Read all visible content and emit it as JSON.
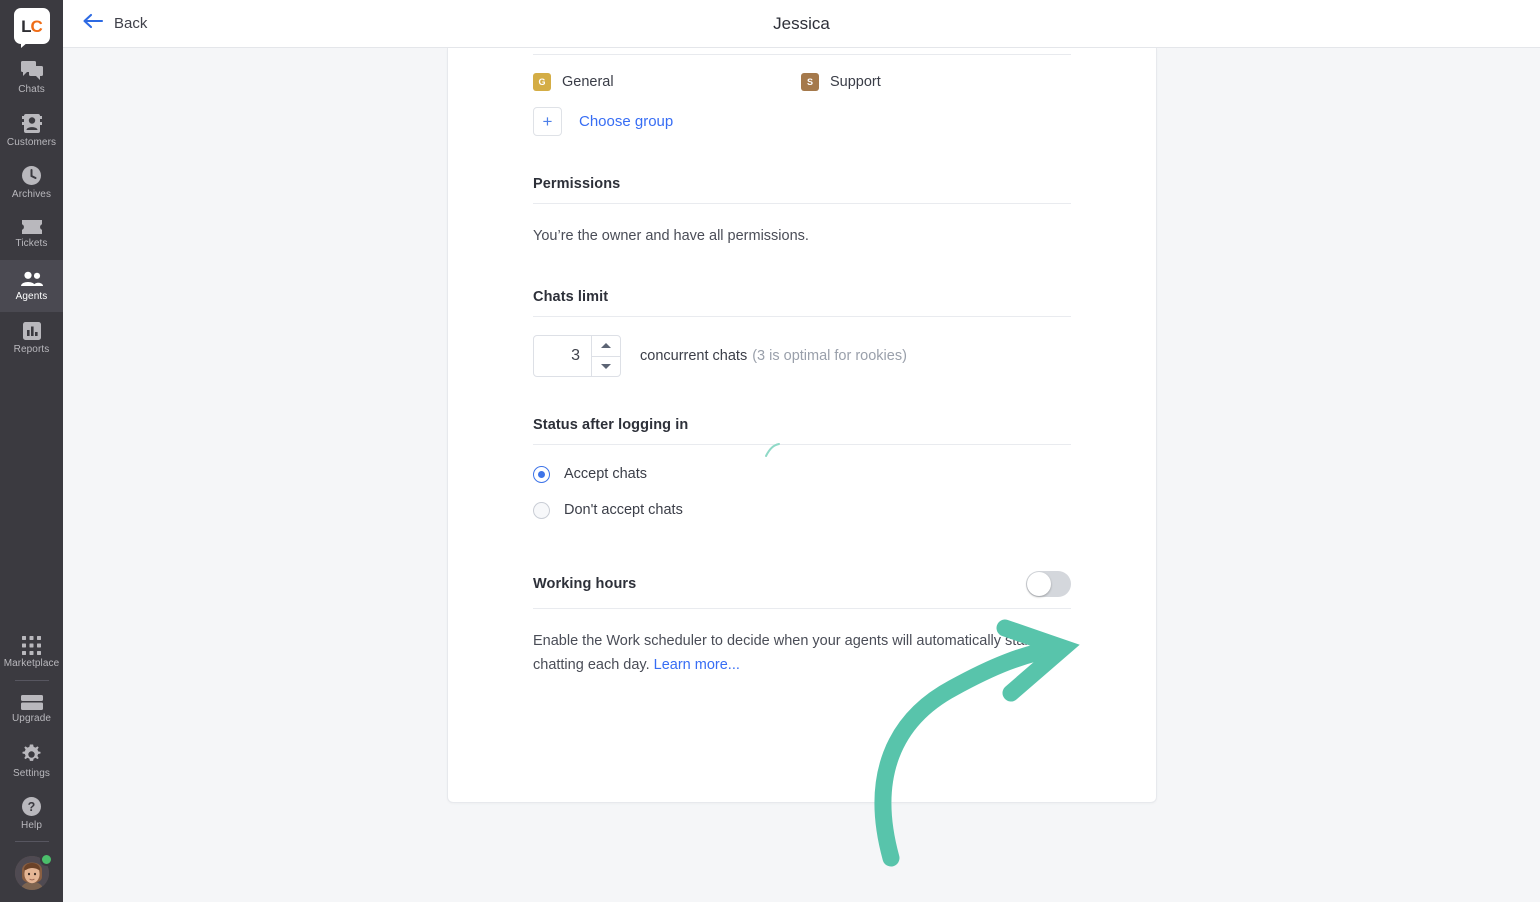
{
  "sidebar": {
    "logo": {
      "text_left": "L",
      "text_right": "C",
      "name": "livechat-logo"
    },
    "items": [
      {
        "label": "Chats",
        "icon": "chats-icon",
        "active": false
      },
      {
        "label": "Customers",
        "icon": "customers-icon",
        "active": false
      },
      {
        "label": "Archives",
        "icon": "archives-icon",
        "active": false
      },
      {
        "label": "Tickets",
        "icon": "tickets-icon",
        "active": false
      },
      {
        "label": "Agents",
        "icon": "agents-icon",
        "active": true
      },
      {
        "label": "Reports",
        "icon": "reports-icon",
        "active": false
      }
    ],
    "bottom_items": [
      {
        "label": "Marketplace",
        "icon": "marketplace-icon"
      },
      {
        "label": "Upgrade",
        "icon": "upgrade-icon"
      },
      {
        "label": "Settings",
        "icon": "gear-icon"
      },
      {
        "label": "Help",
        "icon": "help-icon"
      }
    ],
    "status_color": "#4bbf6b",
    "background": "#3b3a40",
    "active_background": "#4a4951"
  },
  "topbar": {
    "back_label": "Back",
    "back_icon": "arrow-left-icon",
    "back_color": "#2d6ae3",
    "title": "Jessica"
  },
  "groups": {
    "items": [
      {
        "initial": "G",
        "label": "General",
        "color": "#d4ad45"
      },
      {
        "initial": "S",
        "label": "Support",
        "color": "#a5794b"
      }
    ],
    "choose_group_label": "Choose group",
    "plus_icon": "plus-icon",
    "link_color": "#376df4"
  },
  "permissions": {
    "title": "Permissions",
    "text": "You’re the owner and have all permissions."
  },
  "chats_limit": {
    "title": "Chats limit",
    "value": "3",
    "unit_label": "concurrent chats",
    "hint": "(3 is optimal for rookies)",
    "stepper_up_icon": "chevron-up-icon",
    "stepper_down_icon": "chevron-down-icon"
  },
  "status_after_login": {
    "title": "Status after logging in",
    "options": [
      {
        "label": "Accept chats",
        "selected": true
      },
      {
        "label": "Don't accept chats",
        "selected": false
      }
    ],
    "selected_color": "#3e74e8"
  },
  "working_hours": {
    "title": "Working hours",
    "toggle_on": false,
    "description_before": "Enable the Work scheduler to decide when your agents will automatically start chatting each day. ",
    "learn_more_label": "Learn more...",
    "link_color": "#376df4"
  },
  "annotation": {
    "arrow_color": "#58c4ab",
    "arrow_name": "green-curved-arrow-pointing-to-toggle"
  }
}
